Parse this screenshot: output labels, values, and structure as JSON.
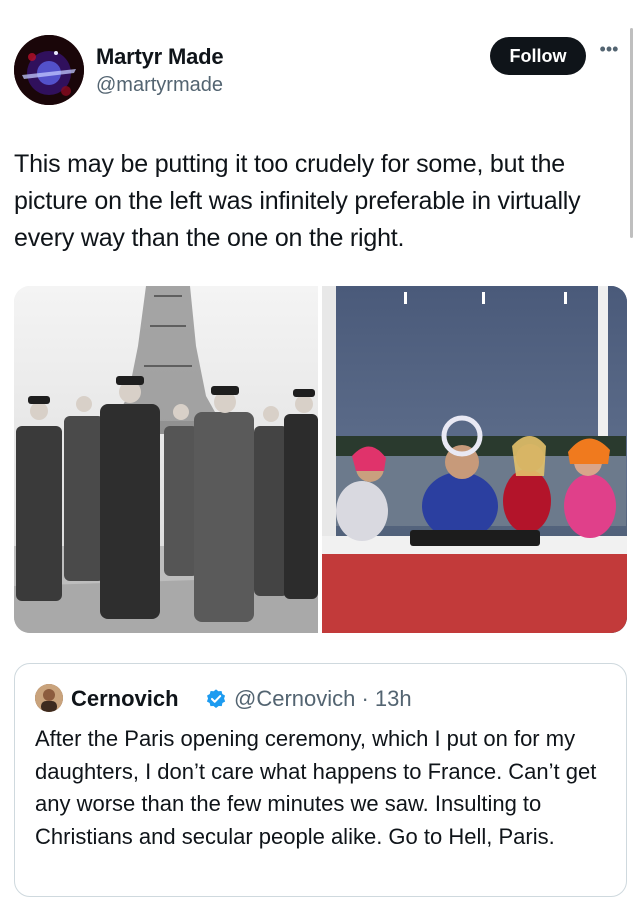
{
  "author": {
    "display_name": "Martyr Made",
    "handle": "@martyrmade",
    "follow_label": "Follow",
    "more_icon": "more-horizontal-icon"
  },
  "tweet": {
    "text": "This may be putting it too crudely for some, but the picture on the left was infinitely preferable in virtually every way than the one on the right."
  },
  "media": {
    "image_count": 2
  },
  "quoted_tweet": {
    "display_name": "Cernovich",
    "verified": true,
    "handle_time": "@Cernovich · 13h",
    "text": "After the Paris opening ceremony, which I put on for my daughters, I don’t care what happens to France. Can’t get any worse than the few minutes we saw. Insulting to Christians and secular people alike. Go to Hell, Paris."
  },
  "colors": {
    "text_primary": "#0f1419",
    "text_secondary": "#536471",
    "follow_bg": "#0f1419",
    "border": "#cfd9de",
    "verified_blue": "#1d9bf0"
  }
}
